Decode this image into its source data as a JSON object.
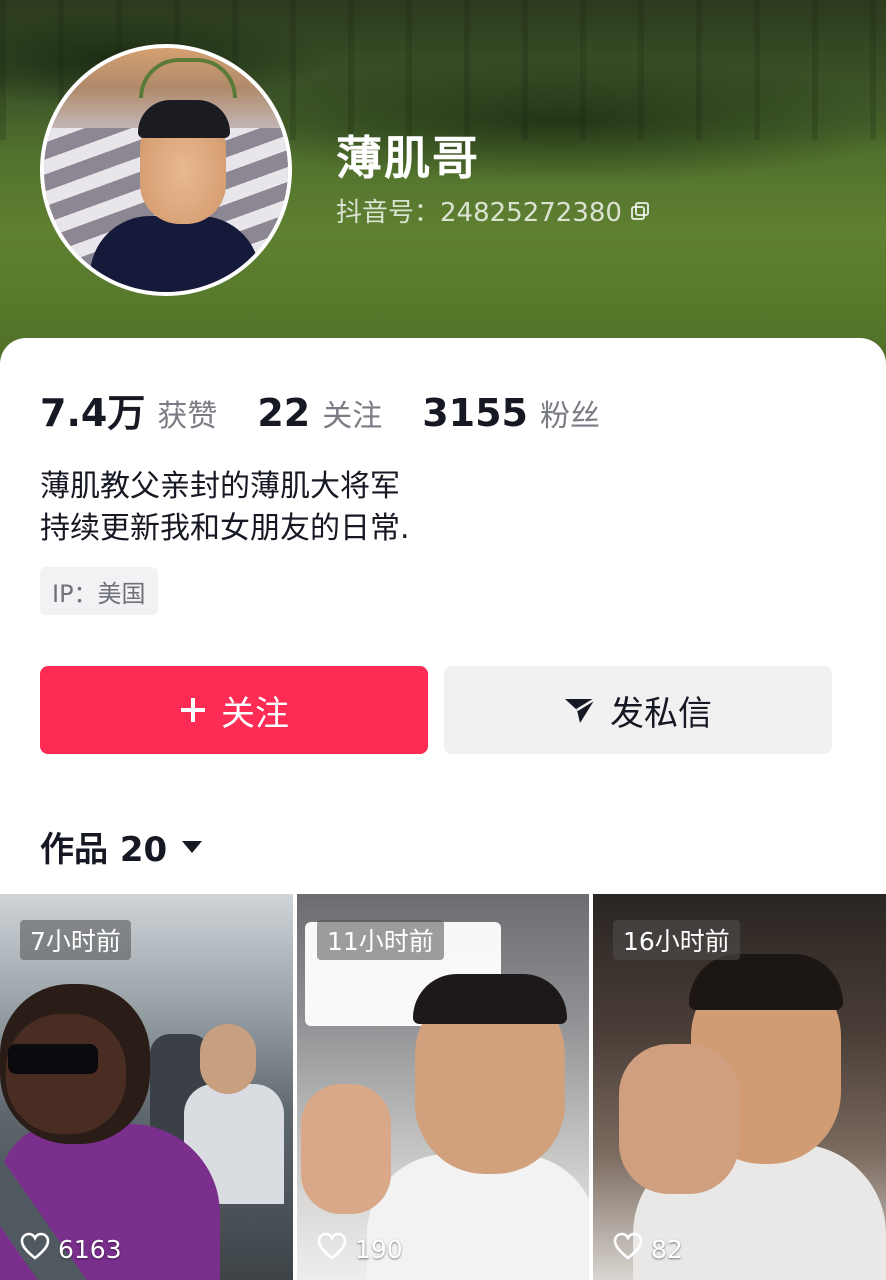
{
  "profile": {
    "name": "薄肌哥",
    "douyin_id_label": "抖音号：24825272380",
    "stats": {
      "likes_value": "7.4万",
      "likes_label": "获赞",
      "following_value": "22",
      "following_label": "关注",
      "followers_value": "3155",
      "followers_label": "粉丝"
    },
    "bio_line1": "薄肌教父亲封的薄肌大将军",
    "bio_line2": "持续更新我和女朋友的日常.",
    "ip": "IP：美国"
  },
  "actions": {
    "follow_label": "关注",
    "message_label": "发私信"
  },
  "tabs": {
    "works_label": "作品 20"
  },
  "videos": [
    {
      "time": "7小时前",
      "likes": "6163"
    },
    {
      "time": "11小时前",
      "likes": "190"
    },
    {
      "time": "16小时前",
      "likes": "82"
    }
  ],
  "colors": {
    "accent": "#fe2c55",
    "text_primary": "#161823",
    "text_secondary": "#7a7c85"
  },
  "icons": [
    "copy-icon",
    "plus-icon",
    "send-icon",
    "caret-down-icon",
    "heart-icon"
  ]
}
